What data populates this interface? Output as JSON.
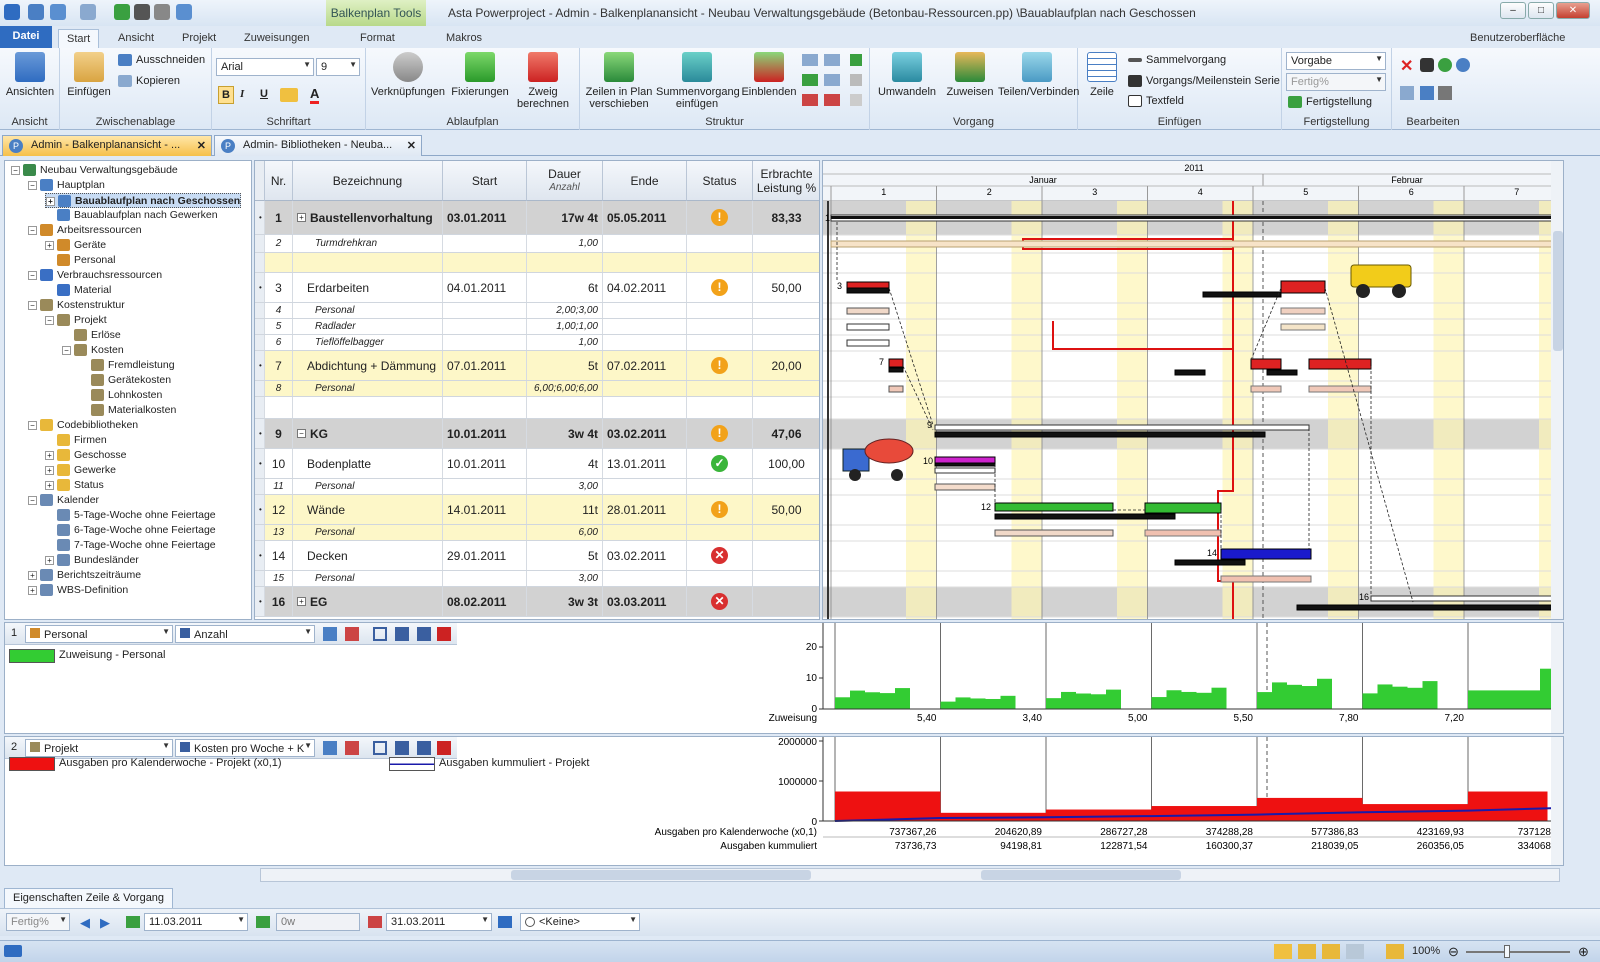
{
  "window": {
    "title": "Asta Powerproject - Admin - Balkenplanansicht - Neubau Verwaltungsgebäude (Betonbau-Ressourcen.pp) \\Bauablaufplan nach Geschossen",
    "context_tab": "Balkenplan Tools",
    "min": "–",
    "max": "□",
    "close": "✕"
  },
  "tabs": {
    "datei": "Datei",
    "start": "Start",
    "ansicht": "Ansicht",
    "projekt": "Projekt",
    "zuweisungen": "Zuweisungen",
    "format": "Format",
    "makros": "Makros",
    "ui_label": "Benutzeroberfläche"
  },
  "ribbon": {
    "ansichten": {
      "btn": "Ansichten",
      "group": "Ansicht"
    },
    "clipboard": {
      "einfuegen": "Einfügen",
      "ausschneiden": "Ausschneiden",
      "kopieren": "Kopieren",
      "group": "Zwischenablage"
    },
    "font": {
      "name": "Arial",
      "size": "9",
      "bold": "B",
      "italic": "I",
      "underline": "U",
      "color": "A",
      "group": "Schriftart"
    },
    "ablauf": {
      "verknuepfungen": "Verknüpfungen",
      "fixierungen": "Fixierungen",
      "zweig": "Zweig",
      "berechnen": "berechnen",
      "group": "Ablaufplan"
    },
    "struktur": {
      "zeilen1": "Zeilen in Plan",
      "zeilen2": "verschieben",
      "summe1": "Summenvorgang",
      "summe2": "einfügen",
      "einblenden": "Einblenden",
      "group": "Struktur"
    },
    "vorgang": {
      "umwandeln": "Umwandeln",
      "zuweisen": "Zuweisen",
      "teilen": "Teilen/Verbinden",
      "group": "Vorgang"
    },
    "einfuegen": {
      "zeile": "Zeile",
      "sammel": "Sammelvorgang",
      "meilenstein": "Vorgangs/Meilenstein Serie",
      "textfeld": "Textfeld",
      "group": "Einfügen"
    },
    "fertig": {
      "vorgabe": "Vorgabe",
      "fertig": "Fertig%",
      "fertigstellung": "Fertigstellung",
      "group": "Fertigstellung"
    },
    "bearbeiten": {
      "group": "Bearbeiten"
    }
  },
  "doc_tabs": [
    {
      "label": "Admin - Balkenplanansicht - ...",
      "close": "✕"
    },
    {
      "label": "Admin- Bibliotheken - Neuba...",
      "close": "✕"
    }
  ],
  "tree": [
    {
      "label": "Neubau Verwaltungsgebäude",
      "lvl": 0,
      "exp": "−",
      "icon": "globe-icon",
      "color": "#3a8a4a"
    },
    {
      "label": "Hauptplan",
      "lvl": 1,
      "exp": "−",
      "icon": "plan-icon",
      "color": "#4a7fc4"
    },
    {
      "label": "Bauablaufplan nach Geschossen",
      "lvl": 2,
      "exp": "+",
      "icon": "chart-icon",
      "color": "#4a7fc4",
      "sel": true
    },
    {
      "label": "Bauablaufplan nach Gewerken",
      "lvl": 2,
      "exp": "",
      "icon": "chart-icon",
      "color": "#4a7fc4"
    },
    {
      "label": "Arbeitsressourcen",
      "lvl": 1,
      "exp": "−",
      "icon": "person-icon",
      "color": "#d08a2a"
    },
    {
      "label": "Geräte",
      "lvl": 2,
      "exp": "+",
      "icon": "person-icon",
      "color": "#d08a2a"
    },
    {
      "label": "Personal",
      "lvl": 2,
      "exp": "",
      "icon": "person-icon",
      "color": "#d08a2a"
    },
    {
      "label": "Verbrauchsressourcen",
      "lvl": 1,
      "exp": "−",
      "icon": "resource-icon",
      "color": "#3a6fc4"
    },
    {
      "label": "Material",
      "lvl": 2,
      "exp": "",
      "icon": "resource-icon",
      "color": "#3a6fc4"
    },
    {
      "label": "Kostenstruktur",
      "lvl": 1,
      "exp": "−",
      "icon": "cost-icon",
      "color": "#9a8a5a"
    },
    {
      "label": "Projekt",
      "lvl": 2,
      "exp": "−",
      "icon": "cost-icon",
      "color": "#9a8a5a"
    },
    {
      "label": "Erlöse",
      "lvl": 3,
      "exp": "",
      "icon": "cost-icon",
      "color": "#9a8a5a"
    },
    {
      "label": "Kosten",
      "lvl": 3,
      "exp": "−",
      "icon": "cost-icon",
      "color": "#9a8a5a"
    },
    {
      "label": "Fremdleistung",
      "lvl": 4,
      "exp": "",
      "icon": "cost-icon",
      "color": "#9a8a5a"
    },
    {
      "label": "Gerätekosten",
      "lvl": 4,
      "exp": "",
      "icon": "cost-icon",
      "color": "#9a8a5a"
    },
    {
      "label": "Lohnkosten",
      "lvl": 4,
      "exp": "",
      "icon": "cost-icon",
      "color": "#9a8a5a"
    },
    {
      "label": "Materialkosten",
      "lvl": 4,
      "exp": "",
      "icon": "cost-icon",
      "color": "#9a8a5a"
    },
    {
      "label": "Codebibliotheken",
      "lvl": 1,
      "exp": "−",
      "icon": "folder-icon",
      "color": "#e8b83a"
    },
    {
      "label": "Firmen",
      "lvl": 2,
      "exp": "",
      "icon": "folder-icon",
      "color": "#e8b83a"
    },
    {
      "label": "Geschosse",
      "lvl": 2,
      "exp": "+",
      "icon": "folder-icon",
      "color": "#e8b83a"
    },
    {
      "label": "Gewerke",
      "lvl": 2,
      "exp": "+",
      "icon": "folder-icon",
      "color": "#e8b83a"
    },
    {
      "label": "Status",
      "lvl": 2,
      "exp": "+",
      "icon": "folder-icon",
      "color": "#e8b83a"
    },
    {
      "label": "Kalender",
      "lvl": 1,
      "exp": "−",
      "icon": "calendar-icon",
      "color": "#6a8ab4"
    },
    {
      "label": "5-Tage-Woche ohne Feiertage",
      "lvl": 2,
      "exp": "",
      "icon": "calendar-icon",
      "color": "#6a8ab4"
    },
    {
      "label": "6-Tage-Woche ohne Feiertage",
      "lvl": 2,
      "exp": "",
      "icon": "calendar-icon",
      "color": "#6a8ab4"
    },
    {
      "label": "7-Tage-Woche ohne Feiertage",
      "lvl": 2,
      "exp": "",
      "icon": "calendar-icon",
      "color": "#6a8ab4"
    },
    {
      "label": "Bundesländer",
      "lvl": 2,
      "exp": "+",
      "icon": "calendar-icon",
      "color": "#6a8ab4"
    },
    {
      "label": "Berichtszeiträume",
      "lvl": 1,
      "exp": "+",
      "icon": "report-icon",
      "color": "#6a8ab4"
    },
    {
      "label": "WBS-Definition",
      "lvl": 1,
      "exp": "+",
      "icon": "wbs-icon",
      "color": "#6a8ab4"
    }
  ],
  "grid": {
    "headers": {
      "nr": "Nr.",
      "bez": "Bezeichnung",
      "start": "Start",
      "dauer": "Dauer",
      "dauer_sub": "Anzahl",
      "ende": "Ende",
      "status": "Status",
      "erbracht": "Erbrachte",
      "erbracht2": "Leistung %"
    },
    "rows": [
      {
        "nr": "1",
        "bez": "Baustellenvorhaltung",
        "start": "03.01.2011",
        "dauer": "17w 4t",
        "ende": "05.05.2011",
        "status": "warn",
        "pct": "83,33",
        "kind": "summary",
        "exp": "+"
      },
      {
        "nr": "2",
        "bez": "Turmdrehkran",
        "start": "",
        "dauer": "1,00",
        "ende": "",
        "status": "",
        "pct": "",
        "kind": "res"
      },
      {
        "nr": "",
        "bez": "",
        "start": "",
        "dauer": "",
        "ende": "",
        "status": "",
        "pct": "",
        "kind": "blank"
      },
      {
        "nr": "3",
        "bez": "Erdarbeiten",
        "start": "04.01.2011",
        "dauer": "6t",
        "ende": "04.02.2011",
        "status": "warn",
        "pct": "50,00",
        "kind": "task"
      },
      {
        "nr": "4",
        "bez": "Personal",
        "start": "",
        "dauer": "2,00;3,00",
        "ende": "",
        "status": "",
        "pct": "",
        "kind": "res"
      },
      {
        "nr": "5",
        "bez": "Radlader",
        "start": "",
        "dauer": "1,00;1,00",
        "ende": "",
        "status": "",
        "pct": "",
        "kind": "res"
      },
      {
        "nr": "6",
        "bez": "Tieflöffelbagger",
        "start": "",
        "dauer": "1,00",
        "ende": "",
        "status": "",
        "pct": "",
        "kind": "res"
      },
      {
        "nr": "7",
        "bez": "Abdichtung + Dämmung",
        "start": "07.01.2011",
        "dauer": "5t",
        "ende": "07.02.2011",
        "status": "warn",
        "pct": "20,00",
        "kind": "taskY"
      },
      {
        "nr": "8",
        "bez": "Personal",
        "start": "",
        "dauer": "6,00;6,00;6,00",
        "ende": "",
        "status": "",
        "pct": "",
        "kind": "resY"
      },
      {
        "nr": "",
        "bez": "",
        "start": "",
        "dauer": "",
        "ende": "",
        "status": "",
        "pct": "",
        "kind": "blank2"
      },
      {
        "nr": "9",
        "bez": "KG",
        "start": "10.01.2011",
        "dauer": "3w 4t",
        "ende": "03.02.2011",
        "status": "warn",
        "pct": "47,06",
        "kind": "summary",
        "exp": "−"
      },
      {
        "nr": "10",
        "bez": "Bodenplatte",
        "start": "10.01.2011",
        "dauer": "4t",
        "ende": "13.01.2011",
        "status": "ok",
        "pct": "100,00",
        "kind": "task"
      },
      {
        "nr": "11",
        "bez": "Personal",
        "start": "",
        "dauer": "3,00",
        "ende": "",
        "status": "",
        "pct": "",
        "kind": "res"
      },
      {
        "nr": "12",
        "bez": "Wände",
        "start": "14.01.2011",
        "dauer": "11t",
        "ende": "28.01.2011",
        "status": "warn",
        "pct": "50,00",
        "kind": "taskY"
      },
      {
        "nr": "13",
        "bez": "Personal",
        "start": "",
        "dauer": "6,00",
        "ende": "",
        "status": "",
        "pct": "",
        "kind": "resY"
      },
      {
        "nr": "14",
        "bez": "Decken",
        "start": "29.01.2011",
        "dauer": "5t",
        "ende": "03.02.2011",
        "status": "err",
        "pct": "",
        "kind": "task"
      },
      {
        "nr": "15",
        "bez": "Personal",
        "start": "",
        "dauer": "3,00",
        "ende": "",
        "status": "",
        "pct": "",
        "kind": "res"
      },
      {
        "nr": "16",
        "bez": "EG",
        "start": "08.02.2011",
        "dauer": "3w 3t",
        "ende": "03.03.2011",
        "status": "err",
        "pct": "",
        "kind": "summary",
        "exp": "+"
      }
    ]
  },
  "timeline": {
    "year": "2011",
    "months": [
      {
        "label": "Januar"
      },
      {
        "label": "Februar"
      }
    ],
    "weeks": [
      "1",
      "2",
      "3",
      "4",
      "5",
      "6",
      "7"
    ]
  },
  "panel1": {
    "index": "1",
    "resource": "Personal",
    "measure": "Anzahl",
    "legend": "Zuweisung - Personal",
    "legend_color": "#33cc33",
    "row_label": "Zuweisung",
    "values": [
      "5,40",
      "3,40",
      "5,00",
      "5,50",
      "7,80",
      "7,20"
    ],
    "yticks": [
      "20",
      "10",
      "0"
    ]
  },
  "panel2": {
    "index": "2",
    "resource": "Projekt",
    "measure": "Kosten pro Woche + K",
    "legend1": "Ausgaben pro Kalenderwoche - Projekt (x0,1)",
    "legend1_color": "#ee1111",
    "legend2": "Ausgaben kummuliert - Projekt",
    "legend2_color": "#1a1aaa",
    "row1_label": "Ausgaben pro Kalenderwoche (x0,1)",
    "row2_label": "Ausgaben kummuliert",
    "row1": [
      "737367,26",
      "204620,89",
      "286727,28",
      "374288,28",
      "577386,83",
      "423169,93",
      "737128"
    ],
    "row2": [
      "73736,73",
      "94198,81",
      "122871,54",
      "160300,37",
      "218039,05",
      "260356,05",
      "334068"
    ],
    "yticks": [
      "2000000",
      "1000000",
      "0"
    ]
  },
  "chart_data": [
    {
      "type": "bar",
      "title": "",
      "series": [
        {
          "name": "Zuweisung - Personal",
          "values": [
            5.4,
            3.4,
            5.0,
            5.5,
            7.8,
            7.2
          ]
        }
      ],
      "categories": [
        "1",
        "2",
        "3",
        "4",
        "5",
        "6"
      ],
      "ylim": [
        0,
        20
      ]
    },
    {
      "type": "bar",
      "title": "",
      "series": [
        {
          "name": "Ausgaben pro Kalenderwoche - Projekt (x0,1)",
          "values": [
            737367.26,
            204620.89,
            286727.28,
            374288.28,
            577386.83,
            423169.93,
            737128
          ]
        },
        {
          "name": "Ausgaben kummuliert - Projekt",
          "values": [
            73736.73,
            94198.81,
            122871.54,
            160300.37,
            218039.05,
            260356.05,
            334068
          ]
        }
      ],
      "categories": [
        "1",
        "2",
        "3",
        "4",
        "5",
        "6",
        "7"
      ],
      "ylim": [
        0,
        2000000
      ]
    }
  ],
  "props_tab": "Eigenschaften Zeile & Vorgang",
  "propbar": {
    "fertig": "Fertig%",
    "start": "11.03.2011",
    "dauer": "0w",
    "ende": "31.03.2011",
    "keine": "<Keine>"
  },
  "status": {
    "zoom": "100%"
  }
}
